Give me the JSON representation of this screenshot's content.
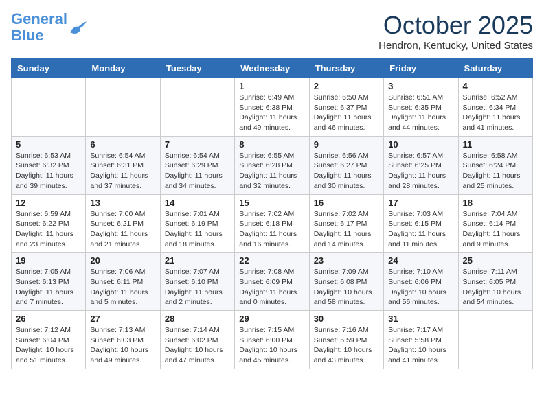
{
  "header": {
    "logo_line1": "General",
    "logo_line2": "Blue",
    "month": "October 2025",
    "location": "Hendron, Kentucky, United States"
  },
  "weekdays": [
    "Sunday",
    "Monday",
    "Tuesday",
    "Wednesday",
    "Thursday",
    "Friday",
    "Saturday"
  ],
  "weeks": [
    [
      {
        "day": "",
        "info": ""
      },
      {
        "day": "",
        "info": ""
      },
      {
        "day": "",
        "info": ""
      },
      {
        "day": "1",
        "info": "Sunrise: 6:49 AM\nSunset: 6:38 PM\nDaylight: 11 hours\nand 49 minutes."
      },
      {
        "day": "2",
        "info": "Sunrise: 6:50 AM\nSunset: 6:37 PM\nDaylight: 11 hours\nand 46 minutes."
      },
      {
        "day": "3",
        "info": "Sunrise: 6:51 AM\nSunset: 6:35 PM\nDaylight: 11 hours\nand 44 minutes."
      },
      {
        "day": "4",
        "info": "Sunrise: 6:52 AM\nSunset: 6:34 PM\nDaylight: 11 hours\nand 41 minutes."
      }
    ],
    [
      {
        "day": "5",
        "info": "Sunrise: 6:53 AM\nSunset: 6:32 PM\nDaylight: 11 hours\nand 39 minutes."
      },
      {
        "day": "6",
        "info": "Sunrise: 6:54 AM\nSunset: 6:31 PM\nDaylight: 11 hours\nand 37 minutes."
      },
      {
        "day": "7",
        "info": "Sunrise: 6:54 AM\nSunset: 6:29 PM\nDaylight: 11 hours\nand 34 minutes."
      },
      {
        "day": "8",
        "info": "Sunrise: 6:55 AM\nSunset: 6:28 PM\nDaylight: 11 hours\nand 32 minutes."
      },
      {
        "day": "9",
        "info": "Sunrise: 6:56 AM\nSunset: 6:27 PM\nDaylight: 11 hours\nand 30 minutes."
      },
      {
        "day": "10",
        "info": "Sunrise: 6:57 AM\nSunset: 6:25 PM\nDaylight: 11 hours\nand 28 minutes."
      },
      {
        "day": "11",
        "info": "Sunrise: 6:58 AM\nSunset: 6:24 PM\nDaylight: 11 hours\nand 25 minutes."
      }
    ],
    [
      {
        "day": "12",
        "info": "Sunrise: 6:59 AM\nSunset: 6:22 PM\nDaylight: 11 hours\nand 23 minutes."
      },
      {
        "day": "13",
        "info": "Sunrise: 7:00 AM\nSunset: 6:21 PM\nDaylight: 11 hours\nand 21 minutes."
      },
      {
        "day": "14",
        "info": "Sunrise: 7:01 AM\nSunset: 6:19 PM\nDaylight: 11 hours\nand 18 minutes."
      },
      {
        "day": "15",
        "info": "Sunrise: 7:02 AM\nSunset: 6:18 PM\nDaylight: 11 hours\nand 16 minutes."
      },
      {
        "day": "16",
        "info": "Sunrise: 7:02 AM\nSunset: 6:17 PM\nDaylight: 11 hours\nand 14 minutes."
      },
      {
        "day": "17",
        "info": "Sunrise: 7:03 AM\nSunset: 6:15 PM\nDaylight: 11 hours\nand 11 minutes."
      },
      {
        "day": "18",
        "info": "Sunrise: 7:04 AM\nSunset: 6:14 PM\nDaylight: 11 hours\nand 9 minutes."
      }
    ],
    [
      {
        "day": "19",
        "info": "Sunrise: 7:05 AM\nSunset: 6:13 PM\nDaylight: 11 hours\nand 7 minutes."
      },
      {
        "day": "20",
        "info": "Sunrise: 7:06 AM\nSunset: 6:11 PM\nDaylight: 11 hours\nand 5 minutes."
      },
      {
        "day": "21",
        "info": "Sunrise: 7:07 AM\nSunset: 6:10 PM\nDaylight: 11 hours\nand 2 minutes."
      },
      {
        "day": "22",
        "info": "Sunrise: 7:08 AM\nSunset: 6:09 PM\nDaylight: 11 hours\nand 0 minutes."
      },
      {
        "day": "23",
        "info": "Sunrise: 7:09 AM\nSunset: 6:08 PM\nDaylight: 10 hours\nand 58 minutes."
      },
      {
        "day": "24",
        "info": "Sunrise: 7:10 AM\nSunset: 6:06 PM\nDaylight: 10 hours\nand 56 minutes."
      },
      {
        "day": "25",
        "info": "Sunrise: 7:11 AM\nSunset: 6:05 PM\nDaylight: 10 hours\nand 54 minutes."
      }
    ],
    [
      {
        "day": "26",
        "info": "Sunrise: 7:12 AM\nSunset: 6:04 PM\nDaylight: 10 hours\nand 51 minutes."
      },
      {
        "day": "27",
        "info": "Sunrise: 7:13 AM\nSunset: 6:03 PM\nDaylight: 10 hours\nand 49 minutes."
      },
      {
        "day": "28",
        "info": "Sunrise: 7:14 AM\nSunset: 6:02 PM\nDaylight: 10 hours\nand 47 minutes."
      },
      {
        "day": "29",
        "info": "Sunrise: 7:15 AM\nSunset: 6:00 PM\nDaylight: 10 hours\nand 45 minutes."
      },
      {
        "day": "30",
        "info": "Sunrise: 7:16 AM\nSunset: 5:59 PM\nDaylight: 10 hours\nand 43 minutes."
      },
      {
        "day": "31",
        "info": "Sunrise: 7:17 AM\nSunset: 5:58 PM\nDaylight: 10 hours\nand 41 minutes."
      },
      {
        "day": "",
        "info": ""
      }
    ]
  ]
}
